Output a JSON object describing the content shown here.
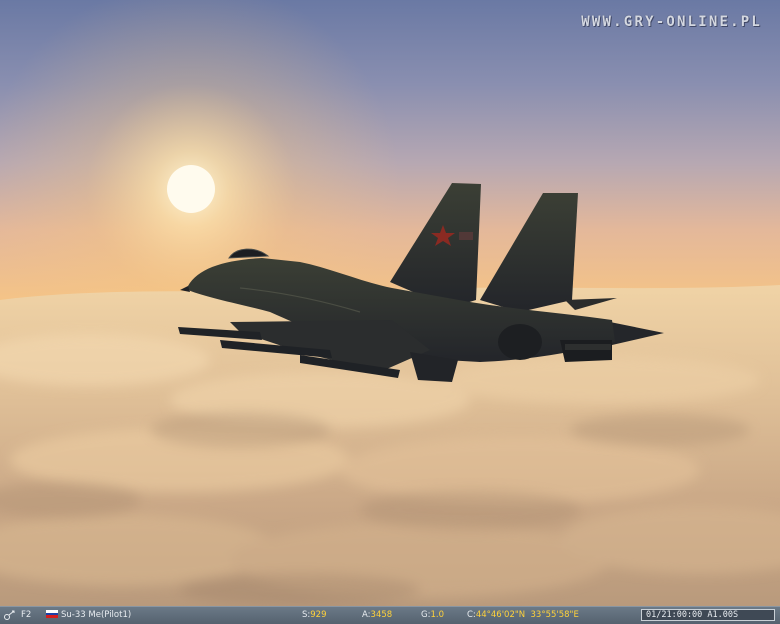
{
  "watermark": "WWW.GRY-ONLINE.PL",
  "hud": {
    "view_key": "F2",
    "country_flag": "russia-flag",
    "unit": "Su-33",
    "pilot": "Me(Pilot1)",
    "speed_label": "S:",
    "speed_value": "929",
    "altitude_label": "A:",
    "altitude_value": "3458",
    "g_label": "G:",
    "g_value": "1.0",
    "coords_label": "C:",
    "coords_value": "44°46'02\"N  33°55'58\"E",
    "time": "01/21:00:00 A1.00S"
  },
  "colors": {
    "flag_white": "#ffffff",
    "flag_blue": "#1c3fa8",
    "flag_red": "#d41e1e",
    "value_yellow": "#ffd23a",
    "status_bar": "#5e6b78"
  }
}
